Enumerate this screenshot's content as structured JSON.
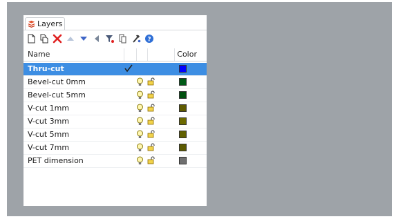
{
  "panel": {
    "tab_label": "Layers",
    "columns": {
      "name": "Name",
      "color": "Color"
    }
  },
  "toolbar": {
    "icons": [
      "new-layer-icon",
      "new-sublayer-icon",
      "delete-icon",
      "move-up-icon",
      "move-down-icon",
      "move-to-parent-icon",
      "filter-icon",
      "copy-icon",
      "tools-icon",
      "help-icon"
    ]
  },
  "layers": [
    {
      "name": "Thru-cut",
      "color": "#0000ff",
      "selected": true,
      "current": true
    },
    {
      "name": "Bevel-cut 0mm",
      "color": "#005a17",
      "selected": false,
      "current": false
    },
    {
      "name": "Bevel-cut 5mm",
      "color": "#00500f",
      "selected": false,
      "current": false
    },
    {
      "name": "V-cut 1mm",
      "color": "#5e5a00",
      "selected": false,
      "current": false
    },
    {
      "name": "V-cut 3mm",
      "color": "#6d6a00",
      "selected": false,
      "current": false
    },
    {
      "name": "V-cut 5mm",
      "color": "#616000",
      "selected": false,
      "current": false
    },
    {
      "name": "V-cut 7mm",
      "color": "#5c5a00",
      "selected": false,
      "current": false
    },
    {
      "name": "PET dimension",
      "color": "#6f6f6f",
      "selected": false,
      "current": false
    }
  ]
}
